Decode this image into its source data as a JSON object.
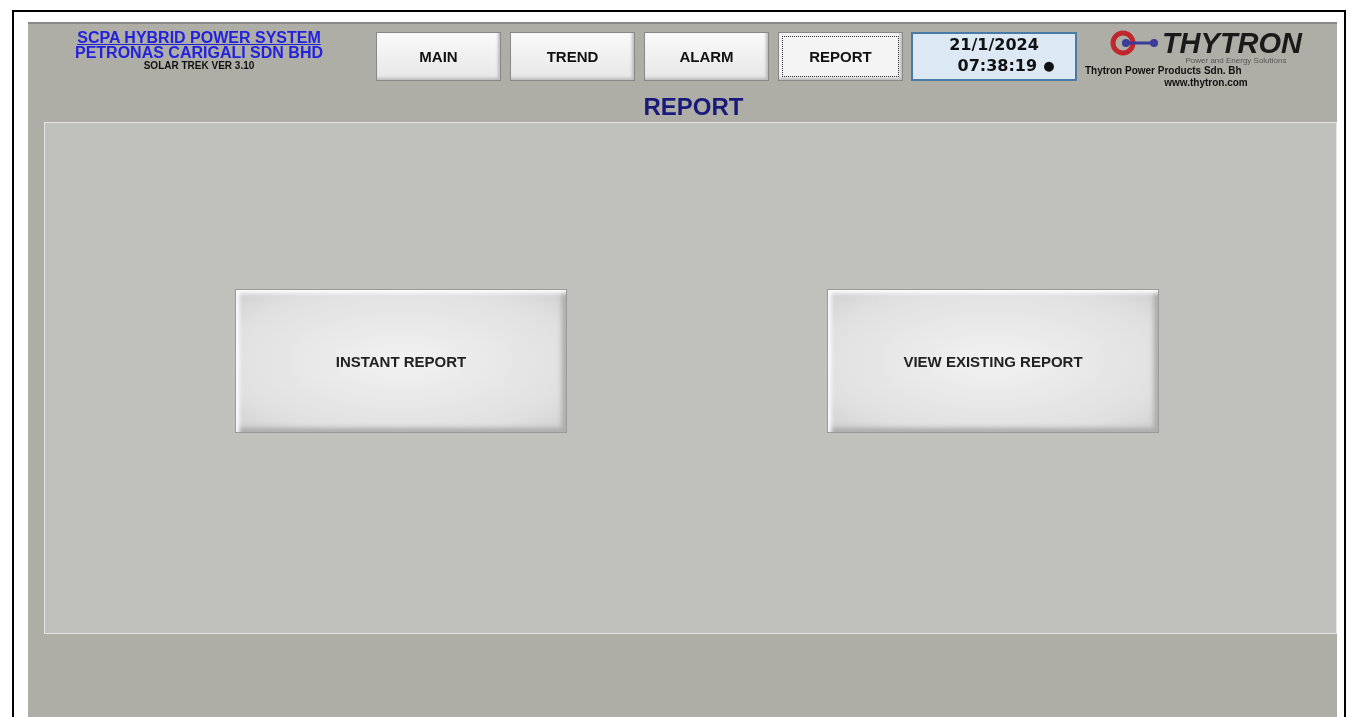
{
  "header": {
    "system_title": "SCPA HYBRID POWER SYSTEM",
    "company": "PETRONAS CARIGALI SDN BHD",
    "version": "SOLAR TREK VER 3.10"
  },
  "tabs": [
    {
      "label": "MAIN",
      "selected": false
    },
    {
      "label": "TREND",
      "selected": false
    },
    {
      "label": "ALARM",
      "selected": false
    },
    {
      "label": "REPORT",
      "selected": true
    }
  ],
  "clock": {
    "date": "21/1/2024",
    "time": "07:38:19",
    "indicator": "●"
  },
  "logo": {
    "brand": "THYTRON",
    "tagline": "Power and Energy Solutions",
    "company": "Thytron Power Products Sdn. Bh",
    "website": "www.thytron.com"
  },
  "page_title": "REPORT",
  "actions": [
    {
      "label": "INSTANT REPORT"
    },
    {
      "label": "VIEW EXISTING REPORT"
    }
  ]
}
